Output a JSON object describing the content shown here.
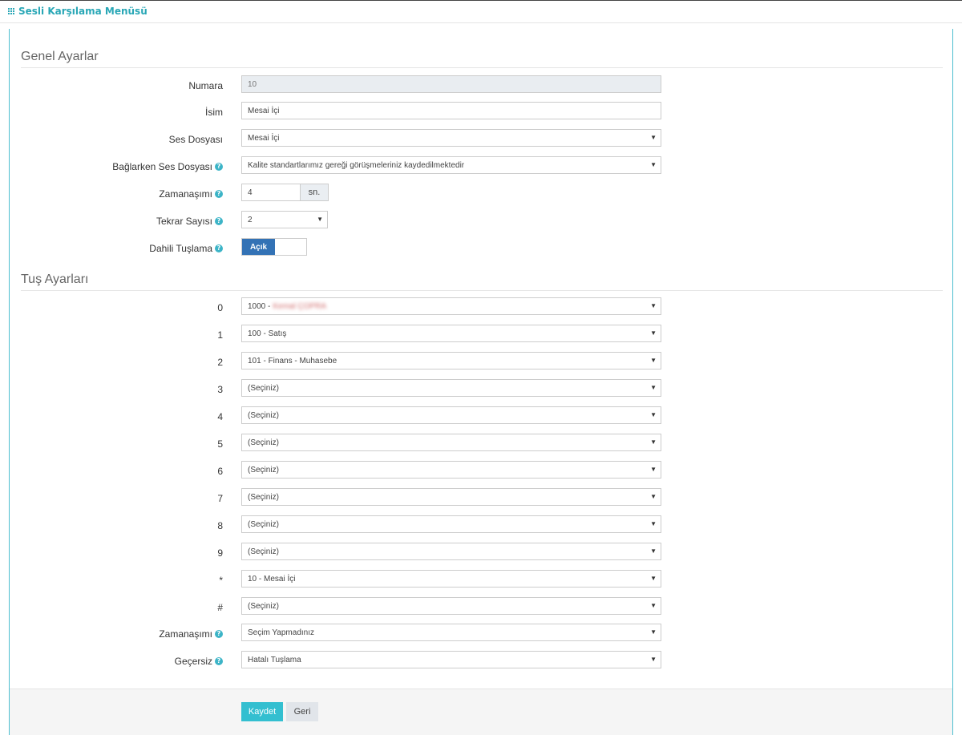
{
  "header": {
    "title": "Sesli Karşılama Menüsü"
  },
  "general": {
    "section_title": "Genel Ayarlar",
    "number_label": "Numara",
    "number_value": "10",
    "name_label": "İsim",
    "name_value": "Mesai İçi",
    "audio_label": "Ses Dosyası",
    "audio_value": "Mesai İçi",
    "connect_audio_label": "Bağlarken Ses Dosyası",
    "connect_audio_value": "Kalite standartlarımız gereği görüşmeleriniz kaydedilmektedir",
    "timeout_label": "Zamanaşımı",
    "timeout_value": "4",
    "timeout_unit": "sn.",
    "repeat_label": "Tekrar Sayısı",
    "repeat_value": "2",
    "internal_label": "Dahili Tuşlama",
    "internal_toggle": "Açık"
  },
  "keys": {
    "section_title": "Tuş Ayarları",
    "rows": [
      {
        "key": "0",
        "value": "1000 -",
        "blurred": "Kemal ÇOPRA"
      },
      {
        "key": "1",
        "value": "100 - Satış"
      },
      {
        "key": "2",
        "value": "101 - Finans - Muhasebe"
      },
      {
        "key": "3",
        "value": "(Seçiniz)"
      },
      {
        "key": "4",
        "value": "(Seçiniz)"
      },
      {
        "key": "5",
        "value": "(Seçiniz)"
      },
      {
        "key": "6",
        "value": "(Seçiniz)"
      },
      {
        "key": "7",
        "value": "(Seçiniz)"
      },
      {
        "key": "8",
        "value": "(Seçiniz)"
      },
      {
        "key": "9",
        "value": "(Seçiniz)"
      },
      {
        "key": "*",
        "value": "10 - Mesai İçi"
      },
      {
        "key": "#",
        "value": "(Seçiniz)"
      }
    ],
    "timeout_label": "Zamanaşımı",
    "timeout_value": "Seçim Yapmadınız",
    "invalid_label": "Geçersiz",
    "invalid_value": "Hatalı Tuşlama"
  },
  "footer": {
    "save_label": "Kaydet",
    "back_label": "Geri"
  },
  "colors": {
    "accent": "#29a7b6",
    "toggle_on": "#3372b5",
    "save_button": "#33bfd0"
  }
}
